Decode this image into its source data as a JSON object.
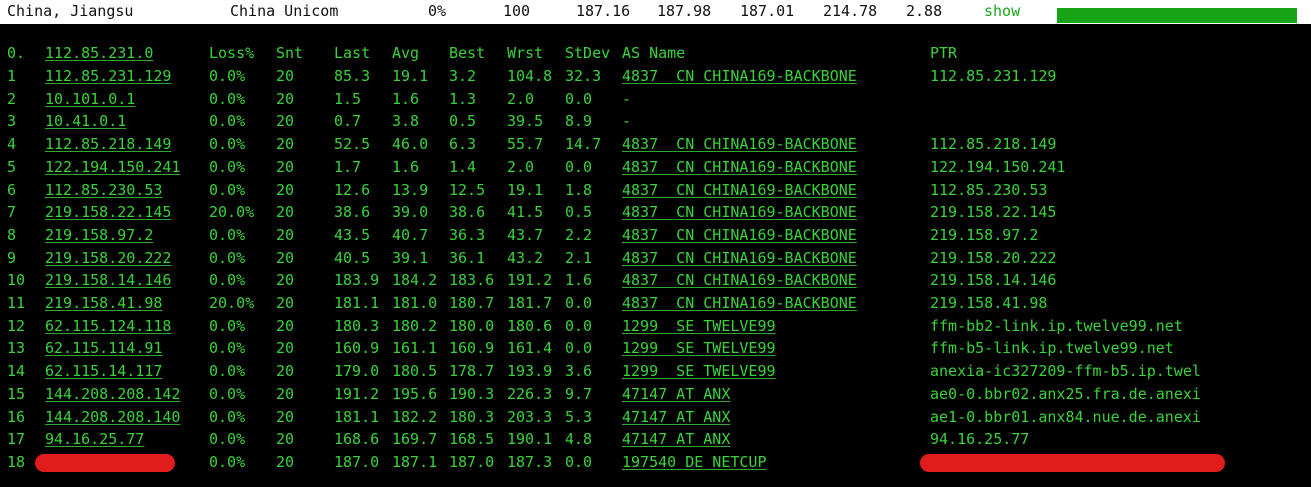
{
  "summary": {
    "location": "China, Jiangsu",
    "isp": "China Unicom",
    "loss": "0%",
    "sent": "100",
    "last": "187.16",
    "avg": "187.98",
    "best": "187.01",
    "worst": "214.78",
    "stdev": "2.88",
    "show_label": "show",
    "progress": 1.0
  },
  "columns": {
    "idx": "0.",
    "host": "112.85.231.0",
    "loss": "Loss%",
    "snt": "Snt",
    "last": "Last",
    "avg": "Avg",
    "best": "Best",
    "wrst": "Wrst",
    "stdev": "StDev",
    "as": "AS Name",
    "ptr": "PTR"
  },
  "hops": [
    {
      "idx": "1",
      "host": "112.85.231.129",
      "loss": "0.0%",
      "snt": "20",
      "last": "85.3",
      "avg": "19.1",
      "best": "3.2",
      "wrst": "104.8",
      "stdev": "32.3",
      "as": "4837  CN CHINA169-BACKBONE",
      "ptr": "112.85.231.129"
    },
    {
      "idx": "2",
      "host": "10.101.0.1",
      "loss": "0.0%",
      "snt": "20",
      "last": "1.5",
      "avg": "1.6",
      "best": "1.3",
      "wrst": "2.0",
      "stdev": "0.0",
      "as": "-",
      "ptr": ""
    },
    {
      "idx": "3",
      "host": "10.41.0.1",
      "loss": "0.0%",
      "snt": "20",
      "last": "0.7",
      "avg": "3.8",
      "best": "0.5",
      "wrst": "39.5",
      "stdev": "8.9",
      "as": "-",
      "ptr": ""
    },
    {
      "idx": "4",
      "host": "112.85.218.149",
      "loss": "0.0%",
      "snt": "20",
      "last": "52.5",
      "avg": "46.0",
      "best": "6.3",
      "wrst": "55.7",
      "stdev": "14.7",
      "as": "4837  CN CHINA169-BACKBONE",
      "ptr": "112.85.218.149"
    },
    {
      "idx": "5",
      "host": "122.194.150.241",
      "loss": "0.0%",
      "snt": "20",
      "last": "1.7",
      "avg": "1.6",
      "best": "1.4",
      "wrst": "2.0",
      "stdev": "0.0",
      "as": "4837  CN CHINA169-BACKBONE",
      "ptr": "122.194.150.241"
    },
    {
      "idx": "6",
      "host": "112.85.230.53",
      "loss": "0.0%",
      "snt": "20",
      "last": "12.6",
      "avg": "13.9",
      "best": "12.5",
      "wrst": "19.1",
      "stdev": "1.8",
      "as": "4837  CN CHINA169-BACKBONE",
      "ptr": "112.85.230.53"
    },
    {
      "idx": "7",
      "host": "219.158.22.145",
      "loss": "20.0%",
      "snt": "20",
      "last": "38.6",
      "avg": "39.0",
      "best": "38.6",
      "wrst": "41.5",
      "stdev": "0.5",
      "as": "4837  CN CHINA169-BACKBONE",
      "ptr": "219.158.22.145"
    },
    {
      "idx": "8",
      "host": "219.158.97.2",
      "loss": "0.0%",
      "snt": "20",
      "last": "43.5",
      "avg": "40.7",
      "best": "36.3",
      "wrst": "43.7",
      "stdev": "2.2",
      "as": "4837  CN CHINA169-BACKBONE",
      "ptr": "219.158.97.2"
    },
    {
      "idx": "9",
      "host": "219.158.20.222",
      "loss": "0.0%",
      "snt": "20",
      "last": "40.5",
      "avg": "39.1",
      "best": "36.1",
      "wrst": "43.2",
      "stdev": "2.1",
      "as": "4837  CN CHINA169-BACKBONE",
      "ptr": "219.158.20.222"
    },
    {
      "idx": "10",
      "host": "219.158.14.146",
      "loss": "0.0%",
      "snt": "20",
      "last": "183.9",
      "avg": "184.2",
      "best": "183.6",
      "wrst": "191.2",
      "stdev": "1.6",
      "as": "4837  CN CHINA169-BACKBONE",
      "ptr": "219.158.14.146"
    },
    {
      "idx": "11",
      "host": "219.158.41.98",
      "loss": "20.0%",
      "snt": "20",
      "last": "181.1",
      "avg": "181.0",
      "best": "180.7",
      "wrst": "181.7",
      "stdev": "0.0",
      "as": "4837  CN CHINA169-BACKBONE",
      "ptr": "219.158.41.98"
    },
    {
      "idx": "12",
      "host": "62.115.124.118",
      "loss": "0.0%",
      "snt": "20",
      "last": "180.3",
      "avg": "180.2",
      "best": "180.0",
      "wrst": "180.6",
      "stdev": "0.0",
      "as": "1299  SE TWELVE99",
      "ptr": "ffm-bb2-link.ip.twelve99.net"
    },
    {
      "idx": "13",
      "host": "62.115.114.91",
      "loss": "0.0%",
      "snt": "20",
      "last": "160.9",
      "avg": "161.1",
      "best": "160.9",
      "wrst": "161.4",
      "stdev": "0.0",
      "as": "1299  SE TWELVE99",
      "ptr": "ffm-b5-link.ip.twelve99.net"
    },
    {
      "idx": "14",
      "host": "62.115.14.117",
      "loss": "0.0%",
      "snt": "20",
      "last": "179.0",
      "avg": "180.5",
      "best": "178.7",
      "wrst": "193.9",
      "stdev": "3.6",
      "as": "1299  SE TWELVE99",
      "ptr": "anexia-ic327209-ffm-b5.ip.twel"
    },
    {
      "idx": "15",
      "host": "144.208.208.142",
      "loss": "0.0%",
      "snt": "20",
      "last": "191.2",
      "avg": "195.6",
      "best": "190.3",
      "wrst": "226.3",
      "stdev": "9.7",
      "as": "47147 AT ANX",
      "ptr": "ae0-0.bbr02.anx25.fra.de.anexi"
    },
    {
      "idx": "16",
      "host": "144.208.208.140",
      "loss": "0.0%",
      "snt": "20",
      "last": "181.1",
      "avg": "182.2",
      "best": "180.3",
      "wrst": "203.3",
      "stdev": "5.3",
      "as": "47147 AT ANX",
      "ptr": "ae1-0.bbr01.anx84.nue.de.anexi"
    },
    {
      "idx": "17",
      "host": "94.16.25.77",
      "loss": "0.0%",
      "snt": "20",
      "last": "168.6",
      "avg": "169.7",
      "best": "168.5",
      "wrst": "190.1",
      "stdev": "4.8",
      "as": "47147 AT ANX",
      "ptr": "94.16.25.77"
    },
    {
      "idx": "18",
      "host": "",
      "loss": "0.0%",
      "snt": "20",
      "last": "187.0",
      "avg": "187.1",
      "best": "187.0",
      "wrst": "187.3",
      "stdev": "0.0",
      "as": "197540 DE NETCUP",
      "ptr": ""
    }
  ],
  "colors": {
    "text": "#3ad23a",
    "background": "#000000",
    "topbar_bg": "#ffffff",
    "progress": "#16a316",
    "redaction": "#e01c1c"
  }
}
